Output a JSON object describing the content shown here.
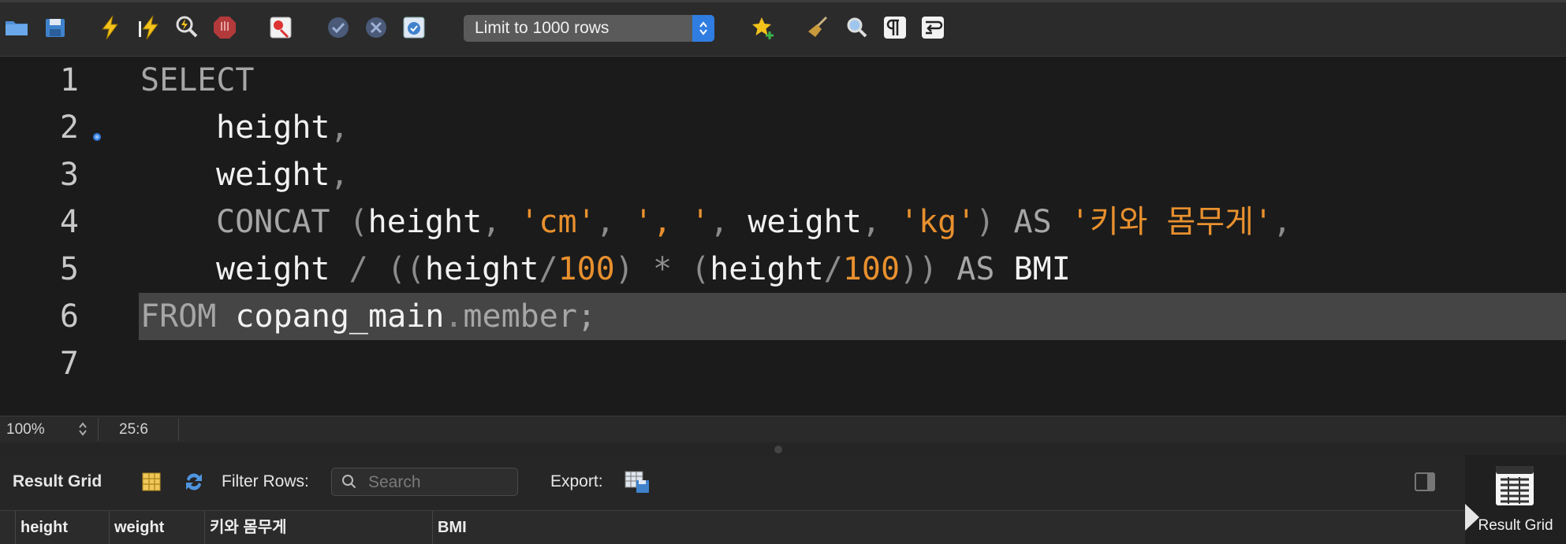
{
  "toolbar": {
    "icons": [
      "open-folder-icon",
      "save-icon",
      "execute-icon",
      "execute-current-icon",
      "explain-icon",
      "stop-icon",
      "stop-on-error-icon",
      "commit-icon",
      "rollback-icon",
      "autocommit-icon",
      "add-snippet-star-icon",
      "beautify-broom-icon",
      "find-icon",
      "invisible-chars-icon",
      "word-wrap-icon"
    ],
    "limit_label": "Limit to 1000 rows"
  },
  "editor": {
    "line_numbers": [
      "1",
      "2",
      "3",
      "4",
      "5",
      "6",
      "7"
    ],
    "lines": {
      "l1": {
        "kw": "SELECT"
      },
      "l2": {
        "ident": "height",
        "comma": ","
      },
      "l3": {
        "ident": "weight",
        "comma": ","
      },
      "l4": {
        "fn": "CONCAT",
        "p1": " (",
        "a1": "height",
        "c1": ", ",
        "s1": "'cm'",
        "c2": ", ",
        "s2": "', '",
        "c3": ", ",
        "a2": "weight",
        "c4": ", ",
        "s3": "'kg'",
        "p2": ") ",
        "as": "AS",
        "sp": " ",
        "alias": "'키와 몸무게'",
        "c5": ","
      },
      "l5": {
        "a1": "weight",
        "op1": " / ",
        "p1": "((",
        "a2": "height",
        "op2": "/",
        "n1": "100",
        "p2": ")",
        "op3": " * ",
        "p3": "(",
        "a3": "height",
        "op4": "/",
        "n2": "100",
        "p4": ")) ",
        "as": "AS",
        "sp": " ",
        "alias": "BMI"
      },
      "l6": {
        "kw": "FROM",
        "sp": " ",
        "schema": "copang_main",
        "dot": ".",
        "table": "member",
        "semi": ";"
      }
    }
  },
  "status": {
    "zoom": "100%",
    "position": "25:6"
  },
  "results": {
    "label": "Result Grid",
    "filter_label": "Filter Rows:",
    "search_placeholder": "Search",
    "export_label": "Export:",
    "columns": [
      "height",
      "weight",
      "키와 몸무게",
      "BMI"
    ]
  },
  "side": {
    "result_grid_label": "Result Grid"
  },
  "colors": {
    "keyword": "#a6a6a6",
    "string": "#e8902e",
    "accent": "#2f7de1"
  }
}
